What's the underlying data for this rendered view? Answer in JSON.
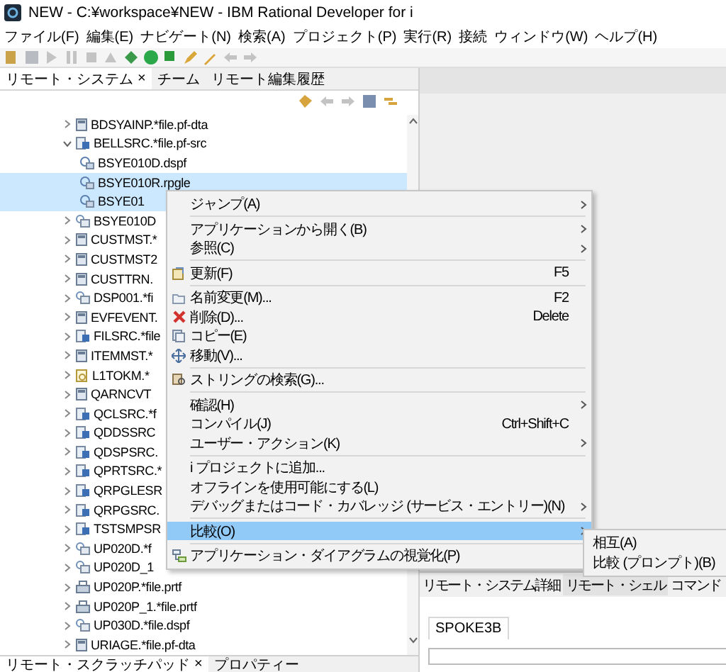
{
  "window": {
    "title": "NEW - C:¥workspace¥NEW - IBM Rational Developer for i"
  },
  "menu_bar": [
    "ファイル(F)",
    "編集(E)",
    "ナビゲート(N)",
    "検索(A)",
    "プロジェクト(P)",
    "実行(R)",
    "接続",
    "ウィンドウ(W)",
    "ヘルプ(H)"
  ],
  "left_tabs": [
    {
      "label": "リモート・システム",
      "close": "×",
      "selected": true
    },
    {
      "label": "チーム",
      "selected": false
    },
    {
      "label": "リモート編集履歴",
      "selected": false
    }
  ],
  "tree": [
    {
      "label": "BDSYAINP.*file.pf-dta",
      "kind": "pf",
      "expanded": false,
      "selected": false
    },
    {
      "label": "BELLSRC.*file.pf-src",
      "kind": "src",
      "expanded": true,
      "selected": false,
      "children": [
        {
          "label": "BSYE010D.dspf",
          "kind": "member",
          "selected": false
        },
        {
          "label": "BSYE010R.rpgle",
          "kind": "member",
          "selected": true
        },
        {
          "label": "BSYE01",
          "kind": "member",
          "selected": true
        }
      ]
    },
    {
      "label": "BSYE010D",
      "kind": "dspf",
      "expanded": false,
      "selected": false
    },
    {
      "label": "CUSTMST.*",
      "kind": "pf",
      "expanded": false,
      "selected": false
    },
    {
      "label": "CUSTMST2",
      "kind": "pf",
      "expanded": false,
      "selected": false
    },
    {
      "label": "CUSTTRN.",
      "kind": "pf",
      "expanded": false,
      "selected": false
    },
    {
      "label": "DSP001.*fi",
      "kind": "dspf",
      "expanded": false,
      "selected": false
    },
    {
      "label": "EVFEVENT.",
      "kind": "pf",
      "expanded": false,
      "selected": false
    },
    {
      "label": "FILSRC.*file",
      "kind": "src",
      "expanded": false,
      "selected": false
    },
    {
      "label": "ITEMMST.*",
      "kind": "pf",
      "expanded": false,
      "selected": false
    },
    {
      "label": "L1TOKM.*",
      "kind": "lf",
      "expanded": false,
      "selected": false
    },
    {
      "label": "QARNCVT",
      "kind": "pf",
      "expanded": false,
      "selected": false
    },
    {
      "label": "QCLSRC.*f",
      "kind": "src",
      "expanded": false,
      "selected": false
    },
    {
      "label": "QDDSSRC",
      "kind": "src",
      "expanded": false,
      "selected": false
    },
    {
      "label": "QDSPSRC.",
      "kind": "src",
      "expanded": false,
      "selected": false
    },
    {
      "label": "QPRTSRC.*",
      "kind": "src",
      "expanded": false,
      "selected": false
    },
    {
      "label": "QRPGLESR",
      "kind": "src",
      "expanded": false,
      "selected": false
    },
    {
      "label": "QRPGSRC.",
      "kind": "src",
      "expanded": false,
      "selected": false
    },
    {
      "label": "TSTSMPSR",
      "kind": "src",
      "expanded": false,
      "selected": false
    },
    {
      "label": "UP020D.*f",
      "kind": "dspf",
      "expanded": false,
      "selected": false
    },
    {
      "label": "UP020D_1",
      "kind": "dspf",
      "expanded": false,
      "selected": false
    },
    {
      "label": "UP020P.*file.prtf",
      "kind": "prtf",
      "expanded": false,
      "selected": false
    },
    {
      "label": "UP020P_1.*file.prtf",
      "kind": "prtf",
      "expanded": false,
      "selected": false
    },
    {
      "label": "UP030D.*file.dspf",
      "kind": "dspf",
      "expanded": false,
      "selected": false
    },
    {
      "label": "URIAGE.*file.pf-dta",
      "kind": "pf",
      "expanded": false,
      "selected": false
    }
  ],
  "bottom_left_tabs": [
    {
      "label": "リモート・スクラッチパッド",
      "close": "×",
      "selected": true
    },
    {
      "label": "プロパティー",
      "selected": false
    }
  ],
  "context_menu": [
    {
      "kind": "item",
      "label": "ジャンプ(A)",
      "submenu": true,
      "selected": false
    },
    {
      "kind": "separator"
    },
    {
      "kind": "item",
      "label": "アプリケーションから開く(B)",
      "submenu": true,
      "selected": false
    },
    {
      "kind": "item",
      "label": "参照(C)",
      "submenu": true,
      "selected": false
    },
    {
      "kind": "separator"
    },
    {
      "kind": "item",
      "label": "更新(F)",
      "shortcut": "F5",
      "submenu": false,
      "selected": false
    },
    {
      "kind": "separator"
    },
    {
      "kind": "item",
      "label": "名前変更(M)...",
      "shortcut": "F2",
      "submenu": false,
      "selected": false
    },
    {
      "kind": "item",
      "label": "削除(D)...",
      "shortcut": "Delete",
      "submenu": false,
      "selected": false
    },
    {
      "kind": "item",
      "label": "コピー(E)",
      "submenu": false,
      "selected": false
    },
    {
      "kind": "item",
      "label": "移動(V)...",
      "submenu": false,
      "selected": false
    },
    {
      "kind": "separator"
    },
    {
      "kind": "item",
      "label": "ストリングの検索(G)...",
      "submenu": false,
      "selected": false
    },
    {
      "kind": "separator"
    },
    {
      "kind": "item",
      "label": "確認(H)",
      "submenu": true,
      "selected": false
    },
    {
      "kind": "item",
      "label": "コンパイル(J)",
      "shortcut": "Ctrl+Shift+C",
      "submenu": false,
      "selected": false
    },
    {
      "kind": "item",
      "label": "ユーザー・アクション(K)",
      "submenu": true,
      "selected": false
    },
    {
      "kind": "separator"
    },
    {
      "kind": "item",
      "label": "i プロジェクトに追加...",
      "submenu": false,
      "selected": false
    },
    {
      "kind": "item",
      "label": "オフラインを使用可能にする(L)",
      "submenu": false,
      "selected": false
    },
    {
      "kind": "item",
      "label": "デバッグまたはコード・カバレッジ (サービス・エントリー)(N)",
      "submenu": true,
      "selected": false
    },
    {
      "kind": "separator"
    },
    {
      "kind": "item",
      "label": "比較(O)",
      "submenu": true,
      "selected": true
    },
    {
      "kind": "separator"
    },
    {
      "kind": "item",
      "label": "アプリケーション・ダイアグラムの視覚化(P)",
      "submenu": false,
      "selected": false
    }
  ],
  "submenu": [
    {
      "label": "相互(A)"
    },
    {
      "label": "比較 (プロンプト)(B)"
    }
  ],
  "right_bottom_tabs": [
    {
      "label": "リモート・システム詳細",
      "selected": false
    },
    {
      "label": "リモート・シェル",
      "selected": true
    },
    {
      "label": "コマンド",
      "selected": false
    }
  ],
  "console_tab": {
    "label": "SPOKE3B"
  }
}
